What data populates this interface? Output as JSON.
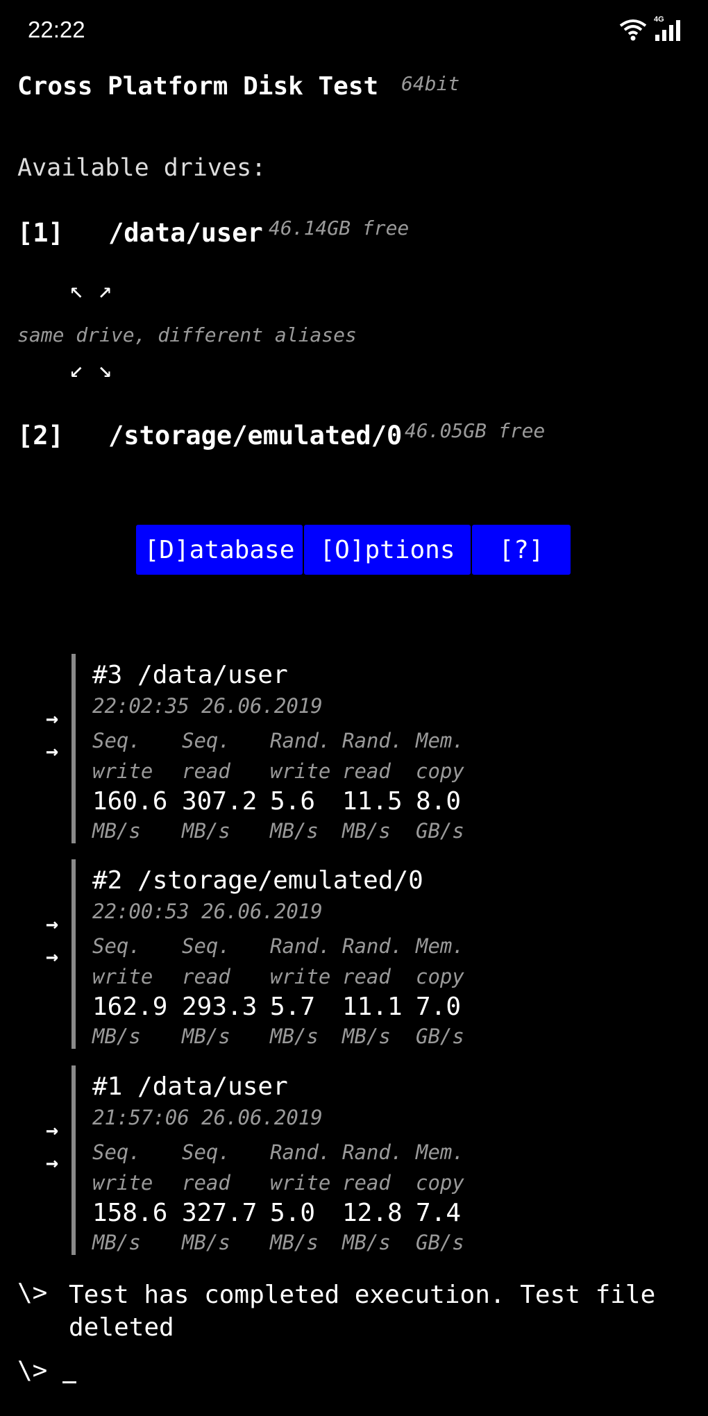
{
  "status_bar": {
    "time": "22:22",
    "network_label": "4G"
  },
  "header": {
    "title": "Cross Platform Disk Test",
    "bitness": "64bit"
  },
  "drives_heading": "Available drives:",
  "drives": [
    {
      "index": "[1]",
      "path": "/data/user",
      "free": "46.14GB free"
    },
    {
      "index": "[2]",
      "path": "/storage/emulated/0",
      "free": "46.05GB free"
    }
  ],
  "alias": {
    "top_arrows": "↖ ↗",
    "note": "same drive, different aliases",
    "bottom_arrows": "↙ ↘"
  },
  "menu": {
    "database": "[D]atabase",
    "options": "[O]ptions",
    "help": "[?]"
  },
  "columns": {
    "headers_line1": [
      "Seq.",
      "Seq.",
      "Rand.",
      "Rand.",
      "Mem."
    ],
    "headers_line2": [
      "write",
      "read",
      "write",
      "read",
      "copy"
    ],
    "units": [
      "MB/s",
      "MB/s",
      "MB/s",
      "MB/s",
      "GB/s"
    ]
  },
  "runs": [
    {
      "title": "#3 /data/user",
      "timestamp": "22:02:35 26.06.2019",
      "values": [
        "160.6",
        "307.2",
        "5.6",
        "11.5",
        "8.0"
      ]
    },
    {
      "title": "#2 /storage/emulated/0",
      "timestamp": "22:00:53 26.06.2019",
      "values": [
        "162.9",
        "293.3",
        "5.7",
        "11.1",
        "7.0"
      ]
    },
    {
      "title": "#1 /data/user",
      "timestamp": "21:57:06 26.06.2019",
      "values": [
        "158.6",
        "327.7",
        "5.0",
        "12.8",
        "7.4"
      ]
    }
  ],
  "run_arrow": "→",
  "console": {
    "prompt": "\\>",
    "message": "Test has completed execution. Test file deleted"
  }
}
